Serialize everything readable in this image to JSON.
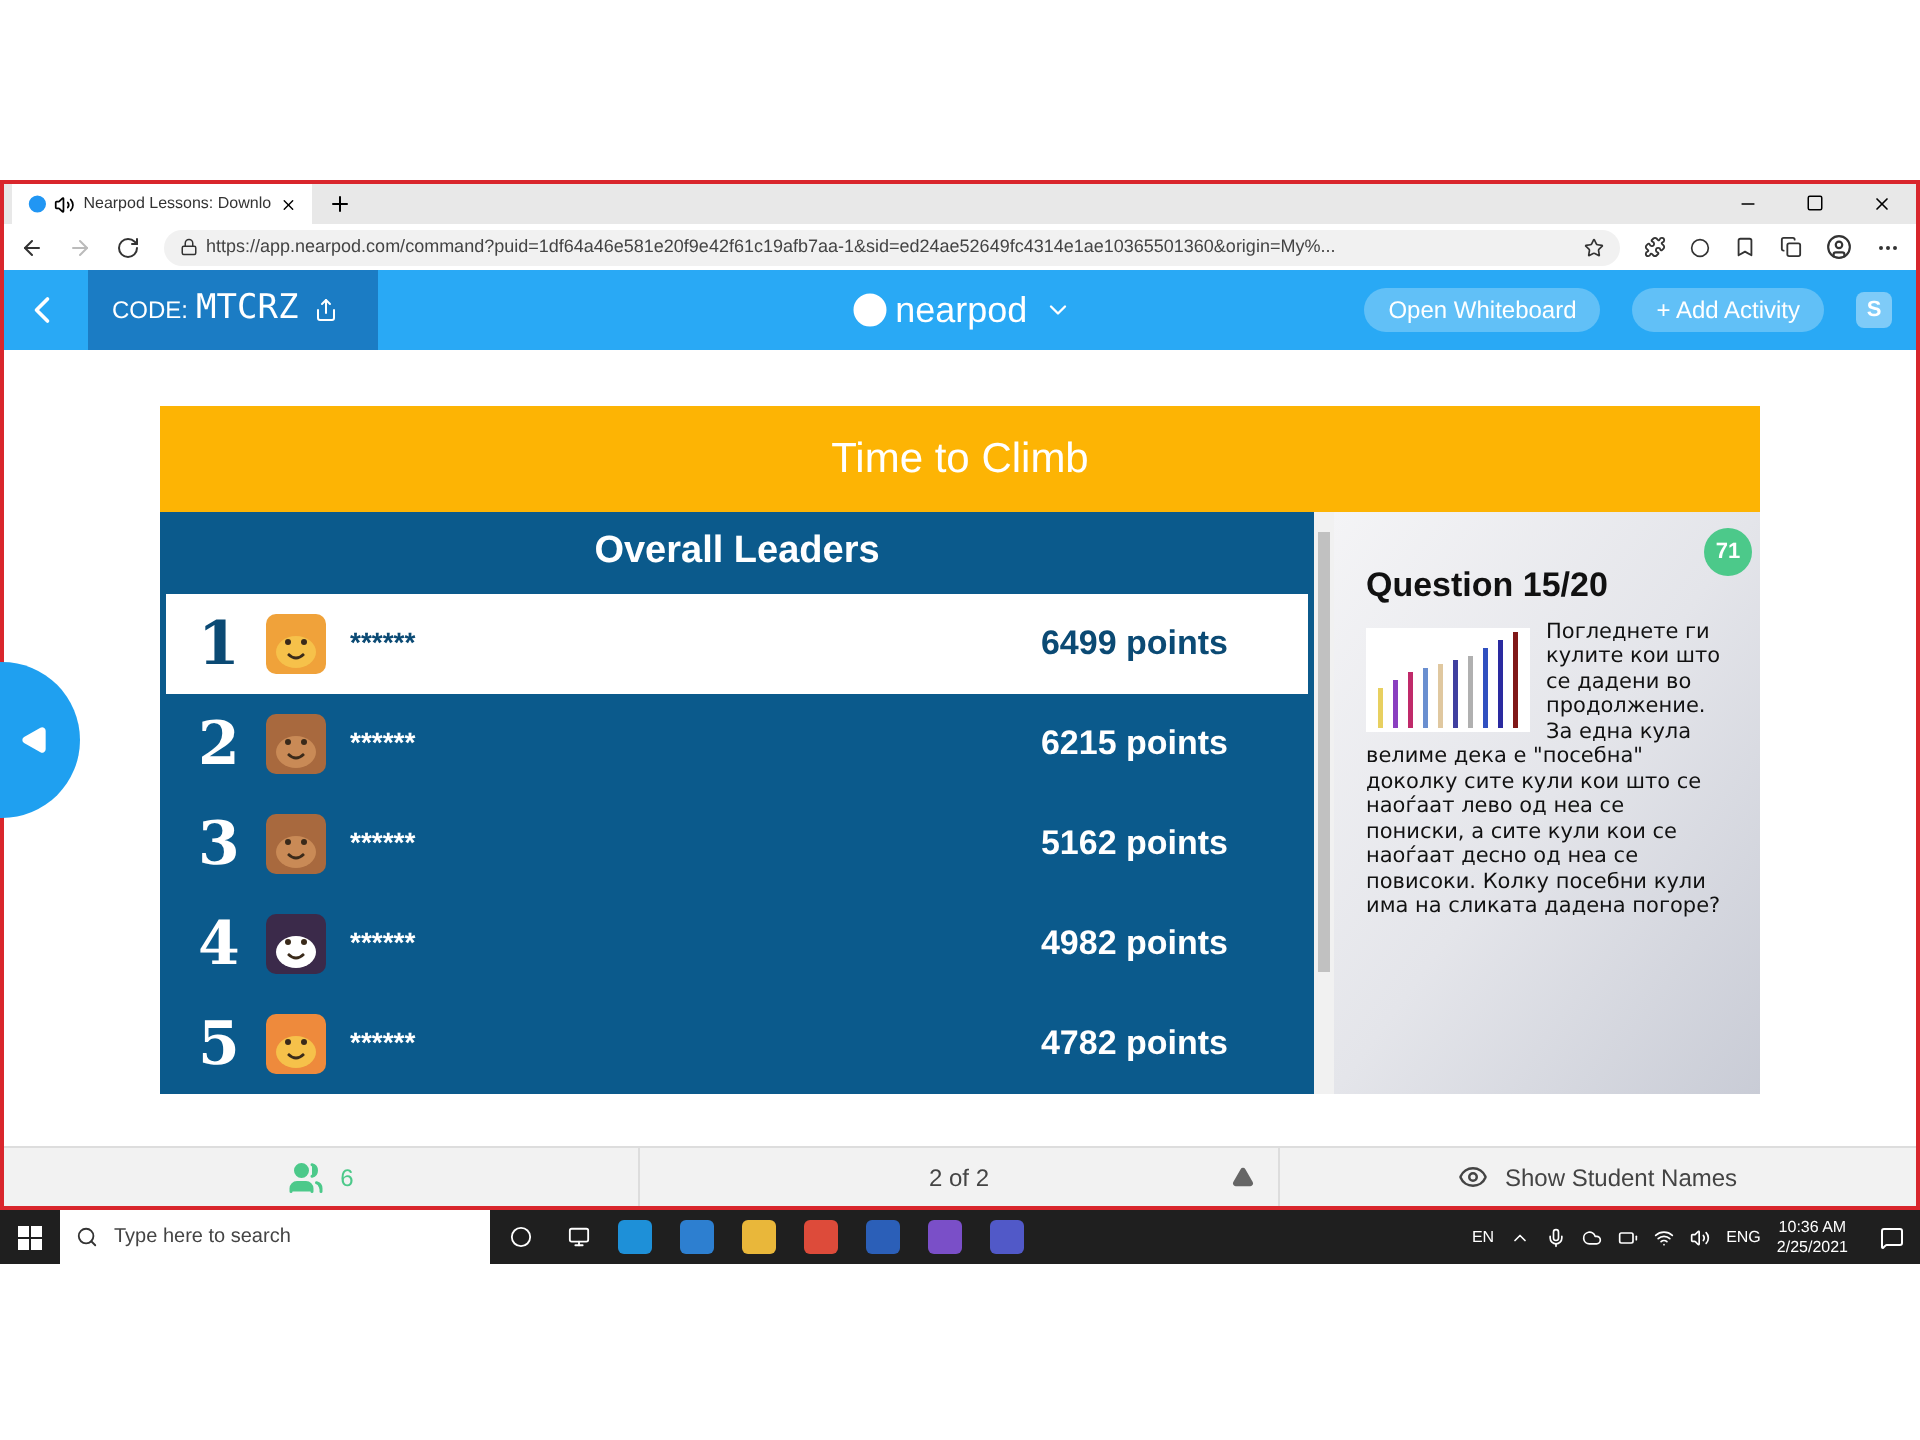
{
  "browser": {
    "tab_title": "Nearpod Lessons: Downlo",
    "url": "https://app.nearpod.com/command?puid=1df64a46e581e20f9e42f61c19afb7aa-1&sid=ed24ae52649fc4314e1ae10365501360&origin=My%..."
  },
  "header": {
    "code_label": "CODE:",
    "code": "MTCRZ",
    "logo": "nearpod",
    "buttons": [
      "Open Whiteboard",
      "+ Add Activity"
    ],
    "profile_letter": "S"
  },
  "banner": {
    "title": "Time to Climb"
  },
  "leaderboard": {
    "title": "Overall Leaders",
    "rows": [
      {
        "rank": "1",
        "name": "******",
        "points": "6499 points",
        "selected": true,
        "kind": "lion"
      },
      {
        "rank": "2",
        "name": "******",
        "points": "6215 points",
        "selected": false,
        "kind": "bear"
      },
      {
        "rank": "3",
        "name": "******",
        "points": "5162 points",
        "selected": false,
        "kind": "bear"
      },
      {
        "rank": "4",
        "name": "******",
        "points": "4982 points",
        "selected": false,
        "kind": "penguin"
      },
      {
        "rank": "5",
        "name": "******",
        "points": "4782 points",
        "selected": false,
        "kind": "fox"
      }
    ]
  },
  "question": {
    "badge": "71",
    "title": "Question 15/20",
    "text_beside": "Погледнете ги кулите кои што се дадени во продолжение. За една кула",
    "text_below": "велиме дека е \"посебна\" доколку сите кули кои што се наоѓаат лево од неа се пониски, а сите кули кои се наоѓаат десно од неа се повисоки. Колку посебни кули има на сликата дадена погоре?"
  },
  "footer": {
    "students": "6",
    "page": "2 of 2",
    "show_names": "Show Student Names"
  },
  "taskbar": {
    "search_placeholder": "Type here to search",
    "input_lang": "EN",
    "lang": "ENG",
    "time": "10:36 AM",
    "date": "2/25/2021"
  }
}
